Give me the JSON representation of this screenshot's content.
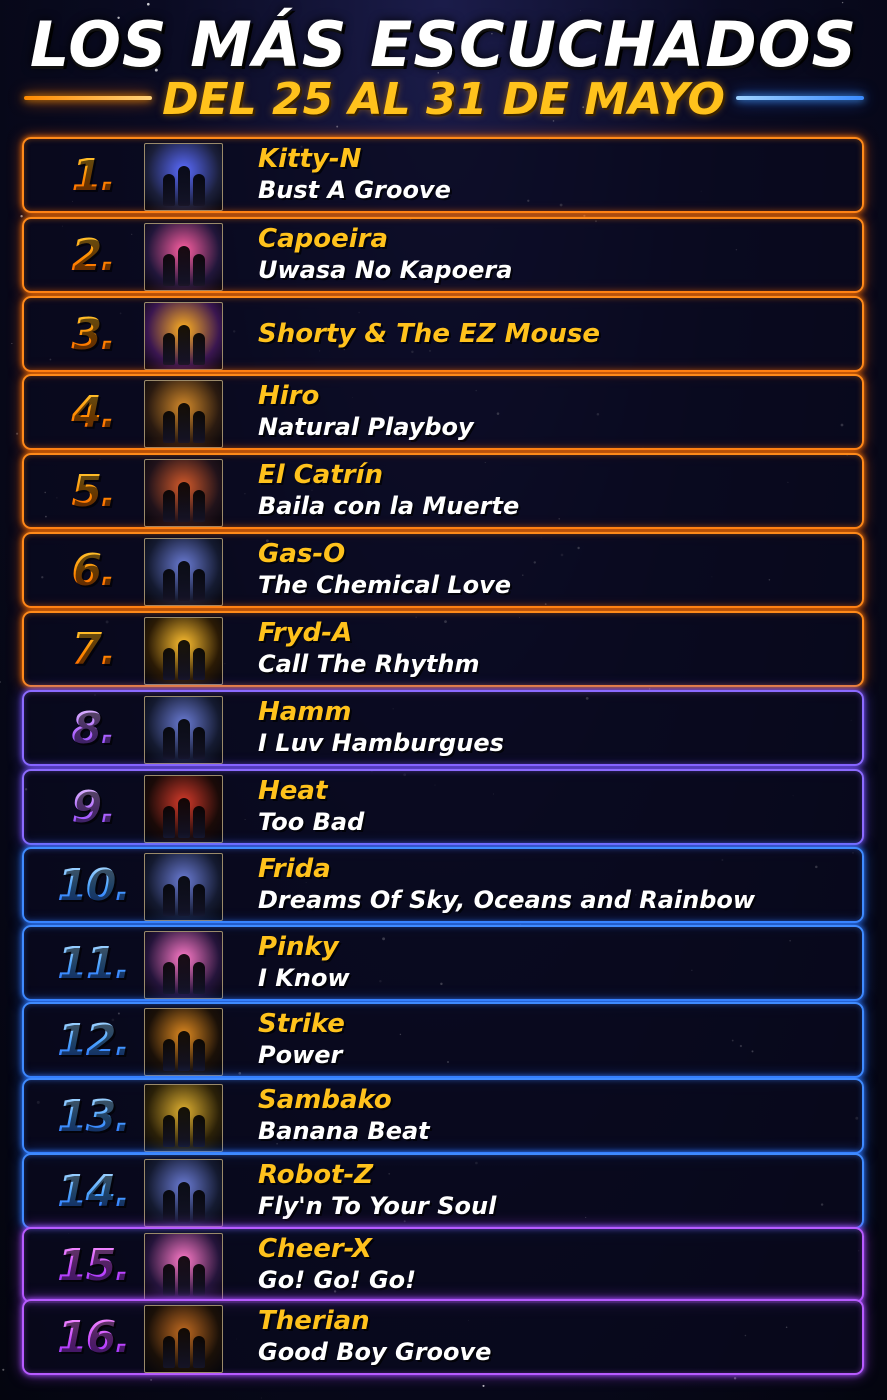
{
  "header": {
    "title": "LOS MÁS ESCUCHADOS",
    "subtitle": "DEL 25 AL 31 DE MAYO"
  },
  "colors": {
    "title": "#ffffff",
    "subtitle": "#ffc21c",
    "artist": "#ffc21c",
    "song": "#ffffff",
    "background": "#0a0b22"
  },
  "entries": [
    {
      "rank": "1.",
      "artist": "Kitty-N",
      "song": "Bust A Groove",
      "theme": "orange"
    },
    {
      "rank": "2.",
      "artist": "Capoeira",
      "song": "Uwasa No Kapoera",
      "theme": "orange"
    },
    {
      "rank": "3.",
      "artist": "Shorty & The EZ Mouse",
      "song": "",
      "theme": "orange"
    },
    {
      "rank": "4.",
      "artist": "Hiro",
      "song": "Natural Playboy",
      "theme": "orange"
    },
    {
      "rank": "5.",
      "artist": "El Catrín",
      "song": "Baila con la Muerte",
      "theme": "orange"
    },
    {
      "rank": "6.",
      "artist": "Gas-O",
      "song": "The Chemical Love",
      "theme": "orange"
    },
    {
      "rank": "7.",
      "artist": "Fryd-A",
      "song": "Call The Rhythm",
      "theme": "orange"
    },
    {
      "rank": "8.",
      "artist": "Hamm",
      "song": "I Luv Hamburgues",
      "theme": "purple"
    },
    {
      "rank": "9.",
      "artist": "Heat",
      "song": "Too Bad",
      "theme": "purple"
    },
    {
      "rank": "10.",
      "artist": "Frida",
      "song": "Dreams Of Sky, Oceans and Rainbow",
      "theme": "blue"
    },
    {
      "rank": "11.",
      "artist": "Pinky",
      "song": "I Know",
      "theme": "blue"
    },
    {
      "rank": "12.",
      "artist": "Strike",
      "song": "Power",
      "theme": "blue"
    },
    {
      "rank": "13.",
      "artist": "Sambako",
      "song": "Banana Beat",
      "theme": "blue"
    },
    {
      "rank": "14.",
      "artist": "Robot-Z",
      "song": "Fly'n To Your Soul",
      "theme": "blue"
    },
    {
      "rank": "15.",
      "artist": "Cheer-X",
      "song": "Go! Go! Go!",
      "theme": "violet"
    },
    {
      "rank": "16.",
      "artist": "Therian",
      "song": "Good Boy Groove",
      "theme": "violet"
    }
  ]
}
